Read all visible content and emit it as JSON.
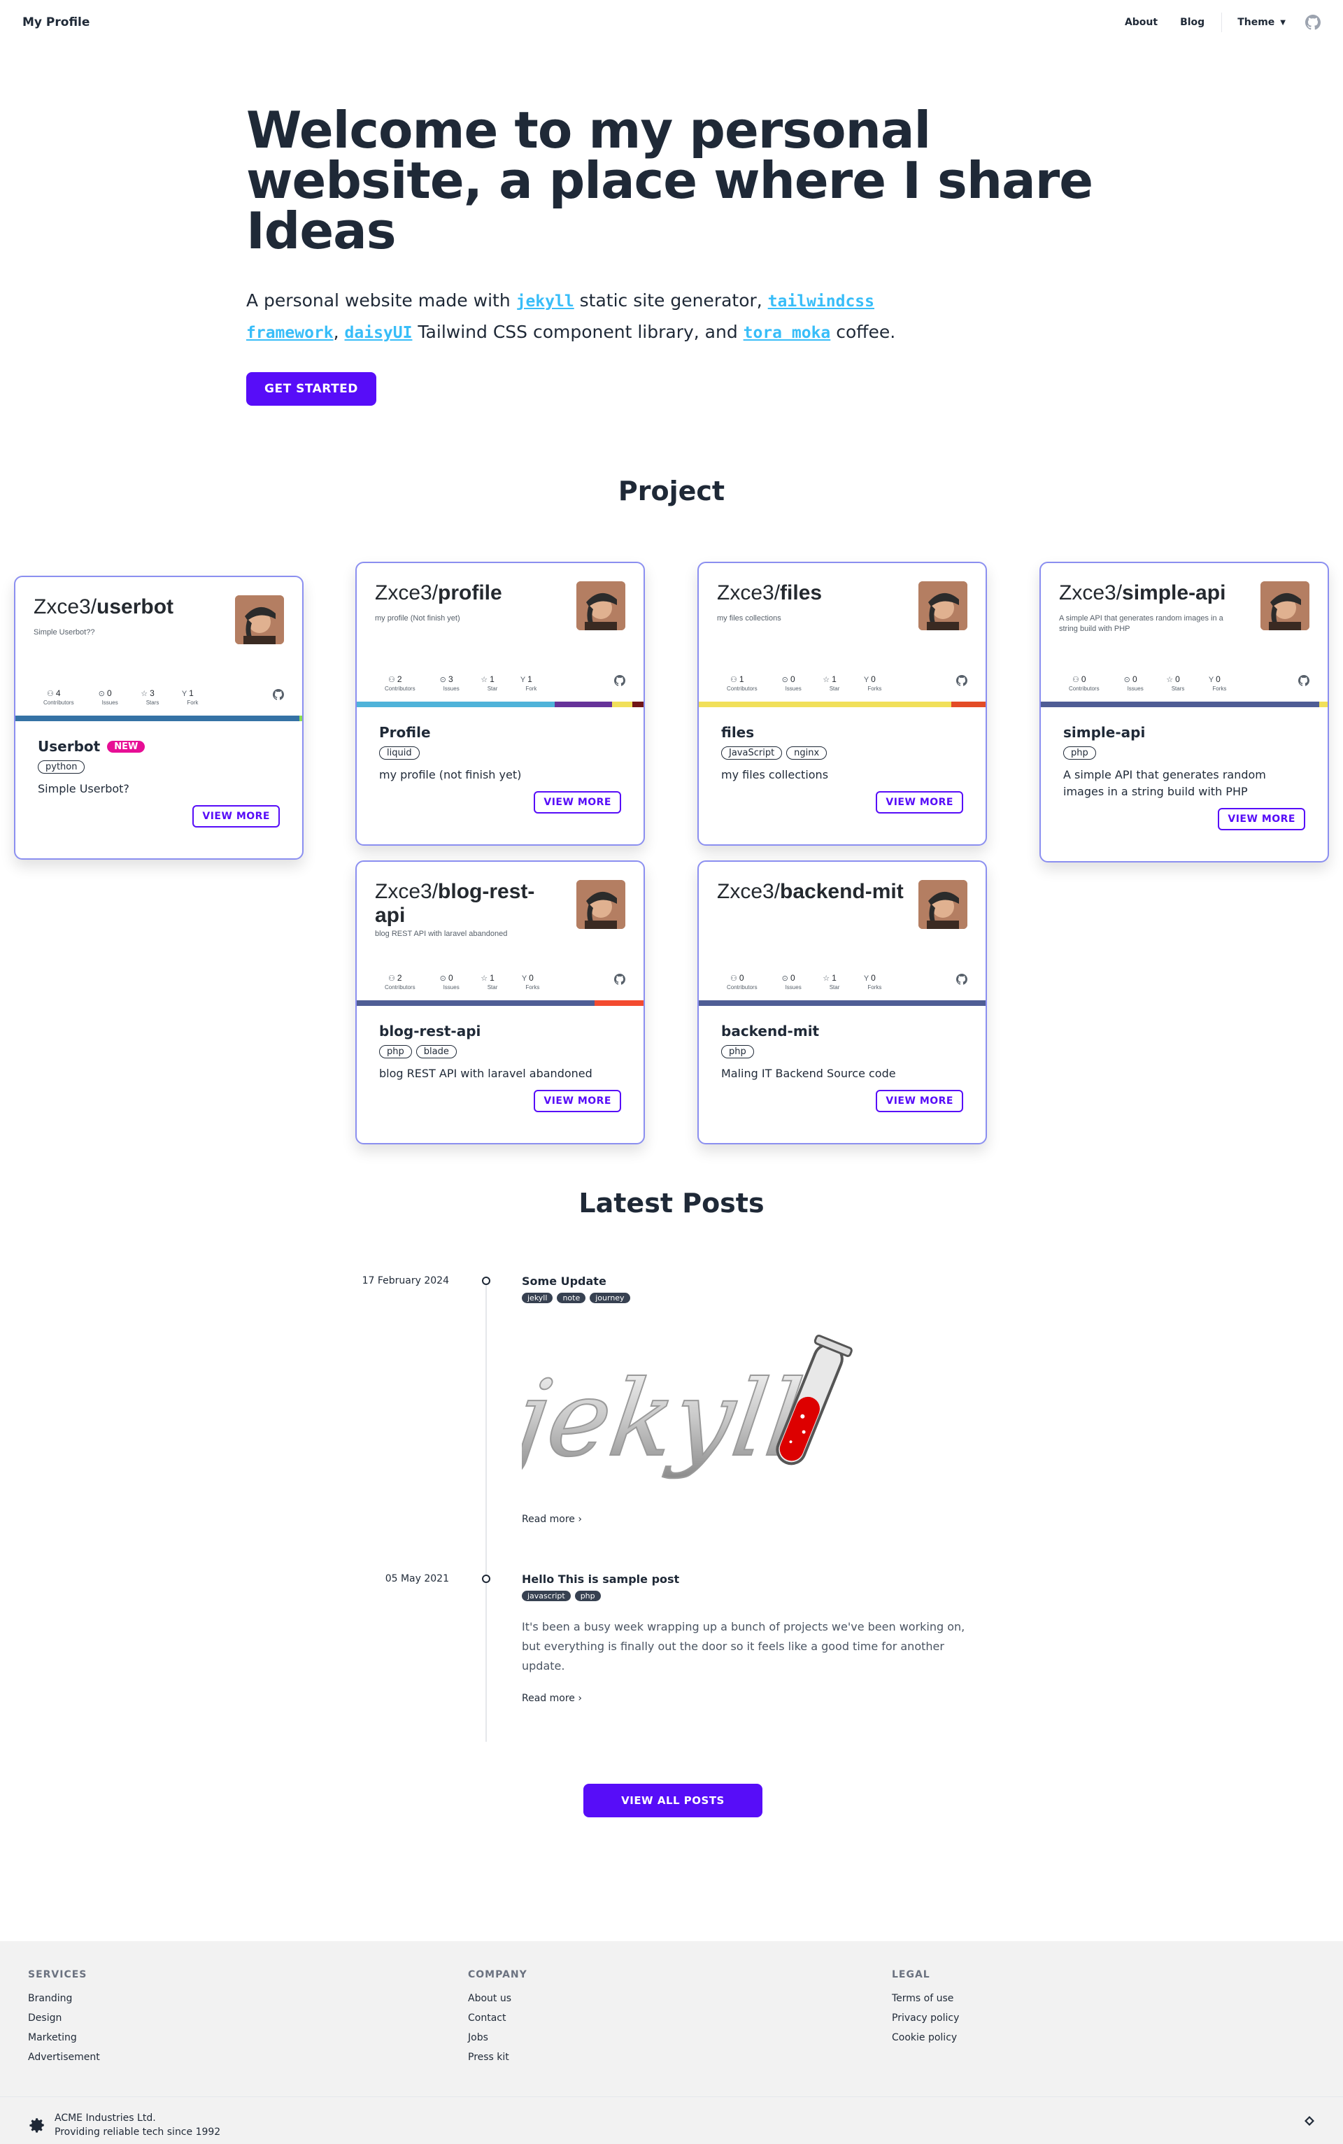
{
  "navbar": {
    "brand": "My Profile",
    "links": [
      "About",
      "Blog"
    ],
    "theme_label": "Theme"
  },
  "hero": {
    "title": "Welcome to my personal website, a place where I share Ideas",
    "text_1": "A personal website made with ",
    "link_jekyll": "jekyll",
    "text_2": " static site generator, ",
    "link_tailwind": "tailwindcss framework",
    "text_3": ", ",
    "link_daisy": "daisyUI",
    "text_4": " Tailwind CSS component library, and ",
    "link_tora": "tora moka",
    "text_5": " coffee.",
    "cta": "GET STARTED"
  },
  "projects": {
    "title": "Project",
    "stat_labels": {
      "contributors": "Contributors",
      "issues": "Issues",
      "stars": "Stars",
      "star": "Star",
      "forks": "Forks",
      "fork": "Fork"
    },
    "items": [
      {
        "owner": "Zxce3/",
        "repo": "userbot",
        "repo_desc": "Simple Userbot??",
        "stats": {
          "contributors": "4",
          "issues": "0",
          "stars": "3",
          "forks": "1"
        },
        "stat_label_keys": [
          "Contributors",
          "Issues",
          "Stars",
          "Fork"
        ],
        "languages": [
          {
            "color": "#3572A5",
            "share": 0.99
          },
          {
            "color": "#89e051",
            "share": 0.01
          }
        ],
        "title": "Userbot",
        "badge": "NEW",
        "tags": [
          "python"
        ],
        "desc": "Simple Userbot?",
        "button": "VIEW MORE"
      },
      {
        "owner": "Zxce3/",
        "repo": "profile",
        "repo_desc": "my profile (Not finish yet)",
        "stats": {
          "contributors": "2",
          "issues": "3",
          "stars": "1",
          "forks": "1"
        },
        "stat_label_keys": [
          "Contributors",
          "Issues",
          "Star",
          "Fork"
        ],
        "languages": [
          {
            "color": "#4fb3d9",
            "share": 0.69
          },
          {
            "color": "#663399",
            "share": 0.2
          },
          {
            "color": "#f1e05a",
            "share": 0.07
          },
          {
            "color": "#701516",
            "share": 0.04
          }
        ],
        "title": "Profile",
        "badge": "",
        "tags": [
          "liquid"
        ],
        "desc": "my profile (not finish yet)",
        "button": "VIEW MORE"
      },
      {
        "owner": "Zxce3/",
        "repo": "files",
        "repo_desc": "my files collections",
        "stats": {
          "contributors": "1",
          "issues": "0",
          "stars": "1",
          "forks": "0"
        },
        "stat_label_keys": [
          "Contributors",
          "Issues",
          "Star",
          "Forks"
        ],
        "languages": [
          {
            "color": "#f1e05a",
            "share": 0.88
          },
          {
            "color": "#e34c26",
            "share": 0.12
          }
        ],
        "title": "files",
        "badge": "",
        "tags": [
          "JavaScript",
          "nginx"
        ],
        "desc": "my files collections",
        "button": "VIEW MORE"
      },
      {
        "owner": "Zxce3/",
        "repo": "simple-api",
        "repo_desc": "A simple API that generates random images in a string build with PHP",
        "stats": {
          "contributors": "0",
          "issues": "0",
          "stars": "0",
          "forks": "0"
        },
        "stat_label_keys": [
          "Contributors",
          "Issues",
          "Stars",
          "Forks"
        ],
        "languages": [
          {
            "color": "#4F5D95",
            "share": 0.97
          },
          {
            "color": "#f1e05a",
            "share": 0.03
          }
        ],
        "title": "simple-api",
        "badge": "",
        "tags": [
          "php"
        ],
        "desc": "A simple API that generates random images in a string build with PHP",
        "button": "VIEW MORE"
      },
      {
        "owner": "Zxce3/",
        "repo": "blog-rest-api",
        "repo_desc": "blog REST API with laravel abandoned",
        "stats": {
          "contributors": "2",
          "issues": "0",
          "stars": "1",
          "forks": "0"
        },
        "stat_label_keys": [
          "Contributors",
          "Issues",
          "Star",
          "Forks"
        ],
        "languages": [
          {
            "color": "#4F5D95",
            "share": 0.83
          },
          {
            "color": "#f34b2f",
            "share": 0.17
          }
        ],
        "title": "blog-rest-api",
        "badge": "",
        "tags": [
          "php",
          "blade"
        ],
        "desc": "blog REST API with laravel abandoned",
        "button": "VIEW MORE"
      },
      {
        "owner": "Zxce3/",
        "repo": "backend-mit",
        "repo_desc": "",
        "stats": {
          "contributors": "0",
          "issues": "0",
          "stars": "1",
          "forks": "0"
        },
        "stat_label_keys": [
          "Contributors",
          "Issues",
          "Star",
          "Forks"
        ],
        "languages": [
          {
            "color": "#4F5D95",
            "share": 1.0
          }
        ],
        "title": "backend-mit",
        "badge": "",
        "tags": [
          "php"
        ],
        "desc": "Maling IT Backend Source code",
        "button": "VIEW MORE"
      }
    ]
  },
  "posts": {
    "title": "Latest Posts",
    "items": [
      {
        "date": "17 February 2024",
        "title": "Some Update",
        "tags": [
          "jekyll",
          "note",
          "journey"
        ],
        "image_text": "jekyll",
        "excerpt": "",
        "read_more": "Read more"
      },
      {
        "date": "05 May 2021",
        "title": "Hello This is sample post",
        "tags": [
          "javascript",
          "php"
        ],
        "excerpt": "It's been a busy week wrapping up a bunch of projects we've been working on, but everything is finally out the door so it feels like a good time for another update.",
        "read_more": "Read more"
      }
    ],
    "view_all": "VIEW ALL POSTS"
  },
  "footer": {
    "services": {
      "title": "SERVICES",
      "links": [
        "Branding",
        "Design",
        "Marketing",
        "Advertisement"
      ]
    },
    "company": {
      "title": "COMPANY",
      "links": [
        "About us",
        "Contact",
        "Jobs",
        "Press kit"
      ]
    },
    "legal": {
      "title": "LEGAL",
      "links": [
        "Terms of use",
        "Privacy policy",
        "Cookie policy"
      ]
    },
    "company_name": "ACME Industries Ltd.",
    "company_tagline": "Providing reliable tech since 1992"
  }
}
